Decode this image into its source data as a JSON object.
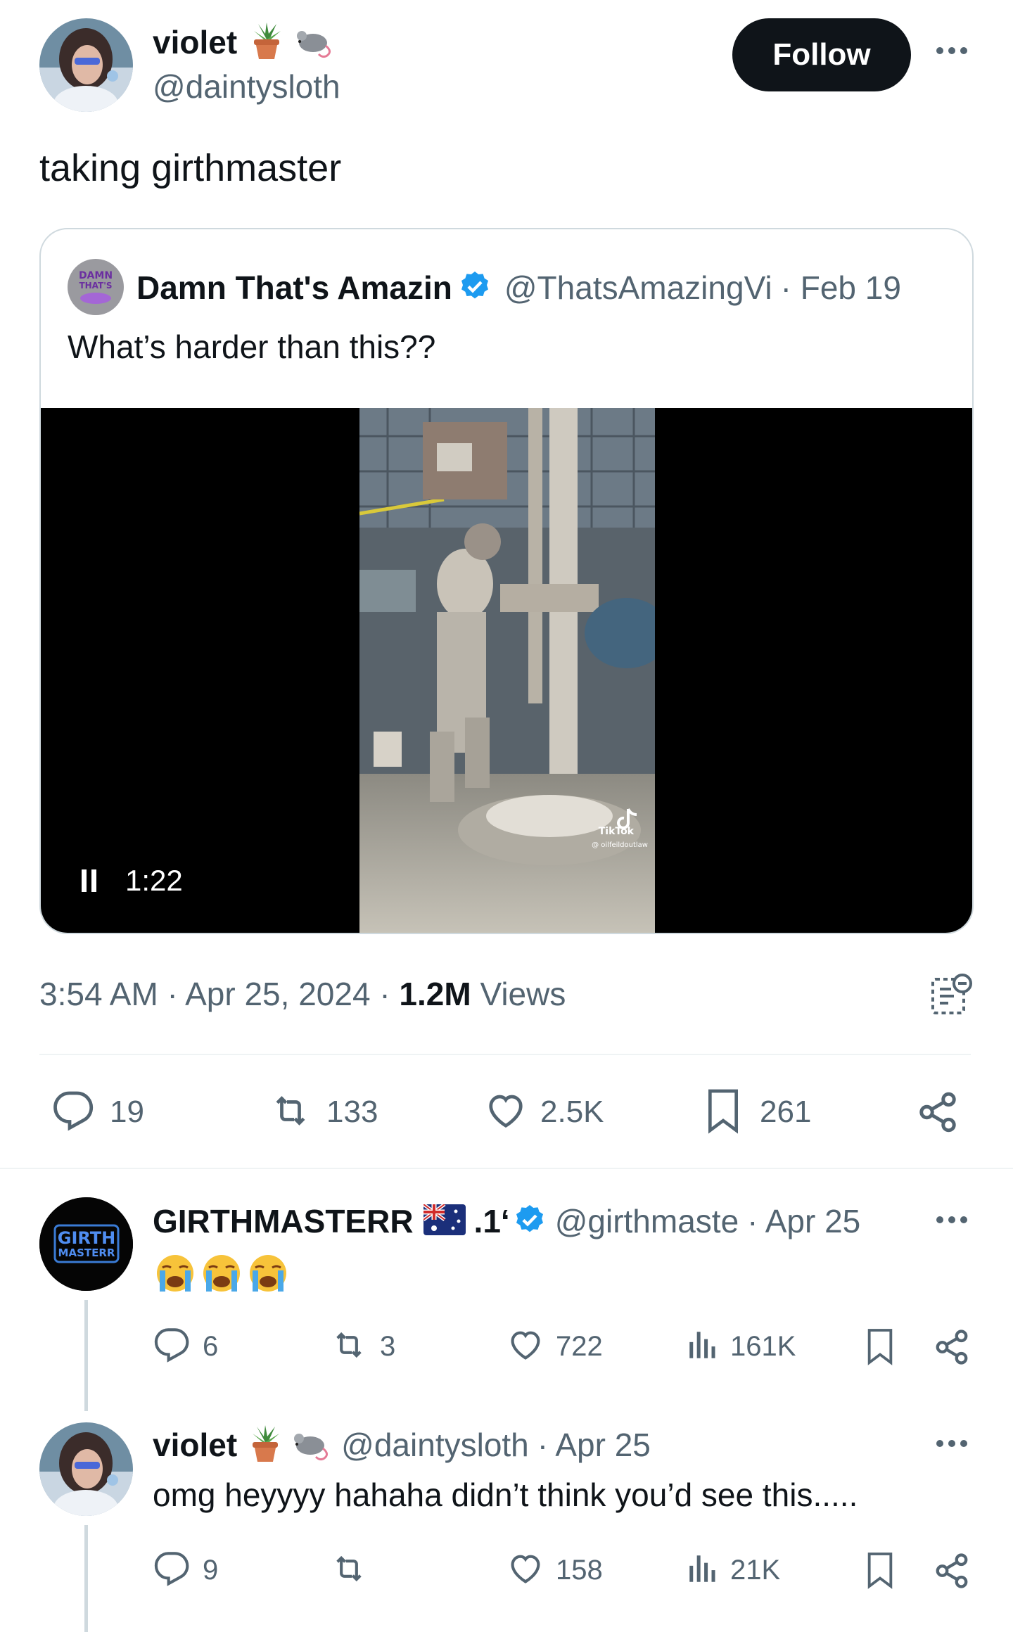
{
  "author": {
    "display_name": "violet",
    "handle": "@daintysloth",
    "name_emojis": [
      "potted-plant",
      "mouse"
    ]
  },
  "follow_button": {
    "label": "Follow"
  },
  "more_label": "···",
  "tweet": {
    "text": "taking girthmaster",
    "timestamp": "3:54 AM · Apr 25, 2024 · ",
    "views_count": "1.2M",
    "views_label": " Views"
  },
  "quote": {
    "display_name": "Damn That's Amazin",
    "handle": "@ThatsAmazingVi",
    "date": "· Feb 19",
    "text": "What’s harder than this??",
    "video": {
      "time": "1:22",
      "tiktok_label": "TikTok",
      "tiktok_user": "@ oilfeildoutlaw"
    },
    "avatar_text": "DAMN THAT'S Amazing"
  },
  "actions": {
    "replies": "19",
    "retweets": "133",
    "likes": "2.5K",
    "bookmarks": "261"
  },
  "replies": [
    {
      "display_name": "GIRTHMASTERR",
      "name_suffix": ".1‘",
      "handle": "@girthmaste",
      "date": "· Apr 25",
      "emojis": [
        "crying-face",
        "crying-face",
        "crying-face"
      ],
      "avatar_text_1": "GIRTH",
      "avatar_text_2": "MASTERR",
      "stats": {
        "replies": "6",
        "retweets": "3",
        "likes": "722",
        "views": "161K"
      }
    },
    {
      "display_name": "violet",
      "handle": "@daintysloth",
      "date": "· Apr 25",
      "text": "omg heyyyy hahaha didn’t think you’d see this.....",
      "stats": {
        "replies": "9",
        "retweets": "",
        "likes": "158",
        "views": "21K"
      }
    }
  ],
  "colors": {
    "text": "#0f1419",
    "secondary": "#536471",
    "verified": "#1d9bf0",
    "follow_bg": "#0f1419"
  }
}
